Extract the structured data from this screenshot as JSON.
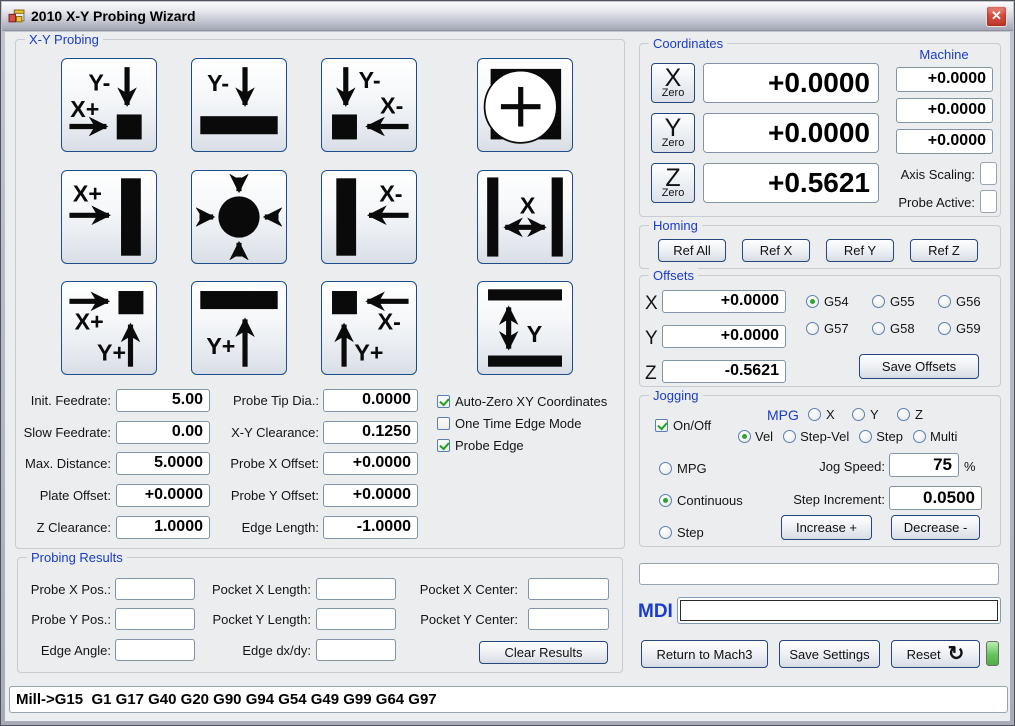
{
  "window": {
    "title": "2010 X-Y Probing Wizard",
    "close_glyph": "✕"
  },
  "colors": {
    "accent_blue": "#1a3ccc",
    "led_green": "#66c45e",
    "close_red": "#cf4a3c"
  },
  "probing": {
    "group_label": "X-Y Probing",
    "icons": [
      {
        "name": "probe-corner-xplus-yminus",
        "t1": "Y-",
        "t2": "X+"
      },
      {
        "name": "probe-edge-yminus",
        "t1": "Y-"
      },
      {
        "name": "probe-corner-xminus-yminus",
        "t1": "Y-",
        "t2": "X-"
      },
      {
        "name": "probe-boss-center"
      },
      {
        "name": "probe-edge-xplus",
        "t1": "X+"
      },
      {
        "name": "probe-pocket-center"
      },
      {
        "name": "probe-edge-xminus",
        "t1": "X-"
      },
      {
        "name": "probe-slot-x",
        "t1": "X"
      },
      {
        "name": "probe-corner-xplus-yplus",
        "t1": "X+",
        "t2": "Y+"
      },
      {
        "name": "probe-edge-yplus",
        "t1": "Y+"
      },
      {
        "name": "probe-corner-xminus-yplus",
        "t1": "X-",
        "t2": "Y+"
      },
      {
        "name": "probe-slot-y",
        "t1": "Y"
      }
    ],
    "fields_left": [
      {
        "label": "Init. Feedrate:",
        "value": "5.00"
      },
      {
        "label": "Slow Feedrate:",
        "value": "0.00"
      },
      {
        "label": "Max. Distance:",
        "value": "5.0000"
      },
      {
        "label": "Plate Offset:",
        "value": "+0.0000"
      },
      {
        "label": "Z Clearance:",
        "value": "1.0000"
      }
    ],
    "fields_right": [
      {
        "label": "Probe Tip Dia.:",
        "value": "0.0000"
      },
      {
        "label": "X-Y Clearance:",
        "value": "0.1250"
      },
      {
        "label": "Probe X Offset:",
        "value": "+0.0000"
      },
      {
        "label": "Probe Y Offset:",
        "value": "+0.0000"
      },
      {
        "label": "Edge Length:",
        "value": "-1.0000"
      }
    ],
    "checkboxes": [
      {
        "label": "Auto-Zero XY Coordinates",
        "checked": true
      },
      {
        "label": "One Time Edge Mode",
        "checked": false
      },
      {
        "label": "Probe Edge",
        "checked": true
      }
    ]
  },
  "results": {
    "group_label": "Probing Results",
    "col1": [
      {
        "label": "Probe X Pos.:",
        "value": ""
      },
      {
        "label": "Probe Y Pos.:",
        "value": ""
      },
      {
        "label": "Edge Angle:",
        "value": ""
      }
    ],
    "col2": [
      {
        "label": "Pocket X Length:",
        "value": ""
      },
      {
        "label": "Pocket Y Length:",
        "value": ""
      },
      {
        "label": "Edge dx/dy:",
        "value": ""
      }
    ],
    "col3": [
      {
        "label": "Pocket X Center:",
        "value": ""
      },
      {
        "label": "Pocket Y Center:",
        "value": ""
      }
    ],
    "clear_button": "Clear Results"
  },
  "coordinates": {
    "group_label": "Coordinates",
    "machine_label": "Machine",
    "axes": [
      {
        "letter": "X",
        "zero_label": "Zero",
        "dro": "+0.0000",
        "machine": "+0.0000"
      },
      {
        "letter": "Y",
        "zero_label": "Zero",
        "dro": "+0.0000",
        "machine": "+0.0000"
      },
      {
        "letter": "Z",
        "zero_label": "Zero",
        "dro": "+0.5621",
        "machine": "+0.0000"
      }
    ],
    "axis_scaling_label": "Axis Scaling:",
    "probe_active_label": "Probe Active:"
  },
  "homing": {
    "group_label": "Homing",
    "buttons": [
      "Ref All",
      "Ref X",
      "Ref Y",
      "Ref Z"
    ]
  },
  "offsets": {
    "group_label": "Offsets",
    "rows": [
      {
        "axis": "X",
        "value": "+0.0000"
      },
      {
        "axis": "Y",
        "value": "+0.0000"
      },
      {
        "axis": "Z",
        "value": "-0.5621"
      }
    ],
    "gcodes": [
      {
        "label": "G54",
        "selected": true
      },
      {
        "label": "G55",
        "selected": false
      },
      {
        "label": "G56",
        "selected": false
      },
      {
        "label": "G57",
        "selected": false
      },
      {
        "label": "G58",
        "selected": false
      },
      {
        "label": "G59",
        "selected": false
      }
    ],
    "save_button": "Save Offsets"
  },
  "jogging": {
    "group_label": "Jogging",
    "onoff": {
      "label": "On/Off",
      "checked": true
    },
    "mpg_label": "MPG",
    "mpg_axes": [
      {
        "label": "X",
        "selected": false
      },
      {
        "label": "Y",
        "selected": false
      },
      {
        "label": "Z",
        "selected": false
      }
    ],
    "modes": [
      {
        "label": "Vel",
        "selected": true
      },
      {
        "label": "Step-Vel",
        "selected": false
      },
      {
        "label": "Step",
        "selected": false
      },
      {
        "label": "Multi",
        "selected": false
      }
    ],
    "jog_types": [
      {
        "label": "MPG",
        "selected": false
      },
      {
        "label": "Continuous",
        "selected": true
      },
      {
        "label": "Step",
        "selected": false
      }
    ],
    "jog_speed": {
      "label": "Jog Speed:",
      "value": "75",
      "unit": "%"
    },
    "step_increment": {
      "label": "Step Increment:",
      "value": "0.0500"
    },
    "increase_button": "Increase +",
    "decrease_button": "Decrease -"
  },
  "mdi": {
    "status_value": "",
    "label": "MDI",
    "value": ""
  },
  "footer": {
    "return_button": "Return to Mach3",
    "save_button": "Save Settings",
    "reset_button": "Reset",
    "reset_icon": "↻"
  },
  "statusbar": {
    "text": "Mill->G15  G1 G17 G40 G20 G90 G94 G54 G49 G99 G64 G97"
  }
}
